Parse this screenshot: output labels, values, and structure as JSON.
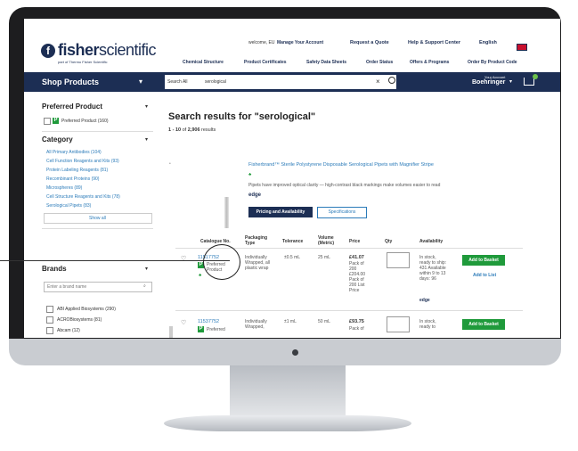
{
  "header": {
    "logo_bold": "fisher",
    "logo_light": "scientific",
    "logo_sub": "part of Thermo Fisher Scientific",
    "welcome": "welcome, EU",
    "manage_account": "Manage Your Account",
    "request_quote": "Request a Quote",
    "help_support": "Help & Support Center",
    "language": "English",
    "flag_icon": "uk-flag-icon",
    "nav_links": [
      "Chemical Structure",
      "Product Certificates",
      "Safety Data Sheets",
      "Order Status",
      "Offers & Programs",
      "Order By Product Code"
    ]
  },
  "navbar": {
    "shop_products": "Shop Products",
    "search_scope": "Search All",
    "search_value": "serological",
    "clear_icon": "close-icon",
    "account_label": "Your Account",
    "account_name": "Boehringer",
    "cart_icon": "cart-icon",
    "colors": {
      "navy": "#1c2e54",
      "green": "#1f9a3b",
      "link": "#2b7bb9"
    }
  },
  "sidebar": {
    "preferred_title": "Preferred Product",
    "preferred_option": "Preferred Product (160)",
    "category_title": "Category",
    "categories": [
      "All Primary Antibodies (104)",
      "Cell Function Reagents and Kits (93)",
      "Protein Labeling Reagents (81)",
      "Recombinant Proteins (90)",
      "Microspheres (89)",
      "Cell Structure Reagents and Kits (78)",
      "Serological Pipets (83)"
    ],
    "show_all": "Show all",
    "brands_title": "Brands",
    "brand_placeholder": "Enter a brand name",
    "brands": [
      "ABI Applied Biosystems (290)",
      "ACROBiosystems (81)",
      "Abcam (12)"
    ]
  },
  "results": {
    "title": "Search results for \"serological\"",
    "count_prefix": "1 - 10",
    "count_mid": "of",
    "count_total": "2,906",
    "count_suffix": "results",
    "product_title": "Fisherbrand™ Sterile Polystyrene Disposable Serological Pipets with Magnifier Stripe",
    "product_desc": "Pipets have improved optical clarity — high-contrast black markings make volumes easier to read",
    "edge_label": "edge",
    "pricing_button": "Pricing and Availability",
    "specs_button": "Specifications",
    "columns": [
      "Catalogue No.",
      "Packaging Type",
      "Tolerance",
      "Volume (Metric)",
      "Price",
      "Qty",
      "Availability"
    ],
    "rows": [
      {
        "catalog": "11517752",
        "preferred": "Preferred Product",
        "packaging": "Individually Wrapped, all plastic wrap",
        "tolerance": "±0.5 mL",
        "volume": "25 mL",
        "price": "£41.07",
        "price_detail": "Pack of 200 £204.00 Pack of 200 List Price",
        "availability": "In stock, ready to ship: 431 Available within 9 to 13 days: 96",
        "availability_edge": "edge",
        "add_button": "Add to Basket",
        "list_link": "Add to List"
      },
      {
        "catalog": "11537752",
        "preferred": "Preferred",
        "packaging": "Individually Wrapped,",
        "tolerance": "±1 mL",
        "volume": "50 mL",
        "price": "£93.75",
        "price_detail": "Pack of",
        "availability": "In stock, ready to",
        "add_button": "Add to Basket"
      }
    ]
  }
}
